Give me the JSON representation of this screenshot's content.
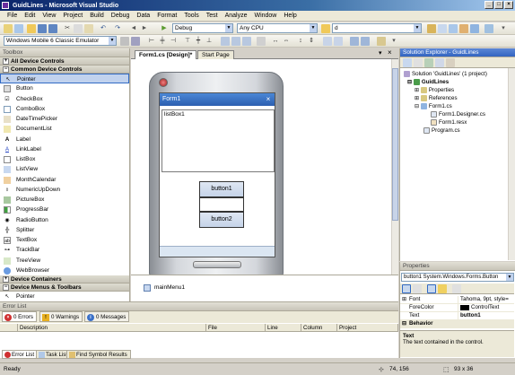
{
  "window": {
    "title": "GuidLines - Microsoft Visual Studio",
    "controls": {
      "minimize": "_",
      "maximize": "□",
      "close": "×"
    }
  },
  "menu": {
    "items": [
      "File",
      "Edit",
      "View",
      "Project",
      "Build",
      "Debug",
      "Data",
      "Format",
      "Tools",
      "Test",
      "Analyze",
      "Window",
      "Help"
    ]
  },
  "toolbar1": {
    "solution_config": "Debug",
    "platform": "Any CPU",
    "find_value": "d"
  },
  "toolbar2": {
    "target_device": "Windows Mobile 6 Classic Emulator"
  },
  "toolbox": {
    "title": "Toolbox",
    "categories": {
      "all": "All Device Controls",
      "common": "Common Device Controls",
      "containers": "Device Containers",
      "menus": "Device Menus & Toolbars"
    },
    "items": [
      "Pointer",
      "Button",
      "CheckBox",
      "ComboBox",
      "DateTimePicker",
      "DocumentList",
      "Label",
      "LinkLabel",
      "ListBox",
      "ListView",
      "MonthCalendar",
      "NumericUpDown",
      "PictureBox",
      "ProgressBar",
      "RadioButton",
      "Splitter",
      "TextBox",
      "TrackBar",
      "TreeView",
      "WebBrowser"
    ],
    "bottom_item": "Pointer"
  },
  "designer": {
    "tabs": [
      "Form1.cs [Design]*",
      "Start Page"
    ],
    "form_title": "Form1",
    "listbox_label": "listBox1",
    "button1": "button1",
    "button2": "button2",
    "tray_component": "mainMenu1"
  },
  "solution_explorer": {
    "title": "Solution Explorer - GuidLines",
    "solution": "Solution 'GuidLines' (1 project)",
    "project": "GuidLines",
    "nodes": [
      "Properties",
      "References",
      "Form1.cs",
      "Form1.Designer.cs",
      "Form1.resx",
      "Program.cs"
    ]
  },
  "properties": {
    "title": "Properties",
    "object": "button1 System.Windows.Forms.Button",
    "rows": [
      {
        "name": "Font",
        "value": "Tahoma, 9pt, style="
      },
      {
        "name": "ForeColor",
        "value": "ControlText"
      },
      {
        "name": "Text",
        "value": "button1"
      }
    ],
    "category": "Behavior",
    "desc_title": "Text",
    "desc_text": "The text contained in the control."
  },
  "error_list": {
    "title": "Error List",
    "tabs": {
      "errors": "0 Errors",
      "warnings": "0 Warnings",
      "messages": "0 Messages"
    },
    "columns": [
      "Description",
      "File",
      "Line",
      "Column",
      "Project"
    ],
    "bottom_tabs": [
      "Error List",
      "Task List",
      "Find Symbol Results"
    ]
  },
  "status": {
    "text": "Ready",
    "position": "74, 156",
    "size": "93 x 36"
  },
  "colors": {
    "title_gradient_start": "#0a246a",
    "accent": "#316ac5",
    "form_title": "#2d5fb0"
  }
}
